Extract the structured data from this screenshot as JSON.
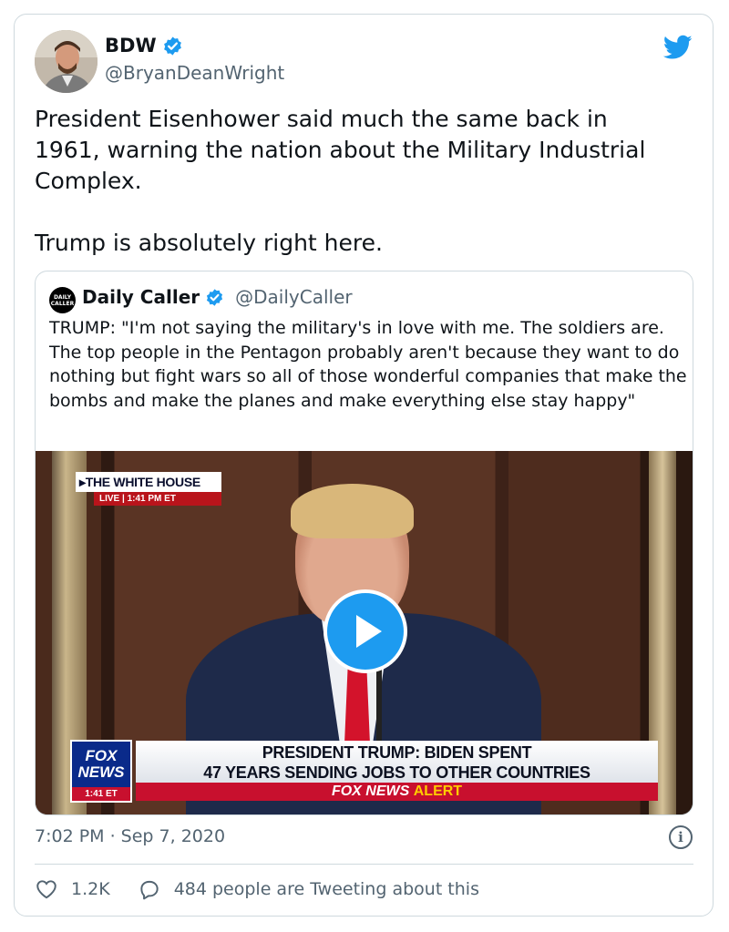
{
  "tweet": {
    "display_name": "BDW",
    "handle": "@BryanDeanWright",
    "text": "President Eisenhower said much the same back in\n1961, warning the nation about the Military Industrial\nComplex.\n\nTrump is absolutely right here.",
    "timestamp": "7:02 PM · Sep 7, 2020",
    "like_count": "1.2K",
    "discussion_text": "484 people are Tweeting about this"
  },
  "quoted_tweet": {
    "display_name": "Daily Caller",
    "handle": "@DailyCaller",
    "avatar_text": "DAILY CALLER",
    "text": "TRUMP: \"I'm not saying the military's in love with me. The soldiers are. The top people in the Pentagon probably aren't because they want to do nothing but fight wars so all of those wonderful companies that make the bombs and make the planes and make everything else stay happy\"",
    "video": {
      "location_banner": "▸THE WHITE HOUSE",
      "live_label": "LIVE  |  1:41 PM ET",
      "network_logo_line1": "FOX",
      "network_logo_line2": "NEWS",
      "network_time": "1:41 ET",
      "headline_line1": "PRESIDENT TRUMP: BIDEN SPENT",
      "headline_line2": "47 YEARS SENDING JOBS TO OTHER COUNTRIES",
      "alert_brand": "FOX NEWS",
      "alert_word": "ALERT"
    }
  },
  "colors": {
    "brand_blue": "#1d9bf0",
    "secondary_text": "#536471",
    "border": "#cfd9de"
  },
  "icons": [
    "twitter-bird-icon",
    "verified-badge-icon",
    "play-icon",
    "info-icon",
    "heart-icon",
    "reply-bubble-icon"
  ]
}
